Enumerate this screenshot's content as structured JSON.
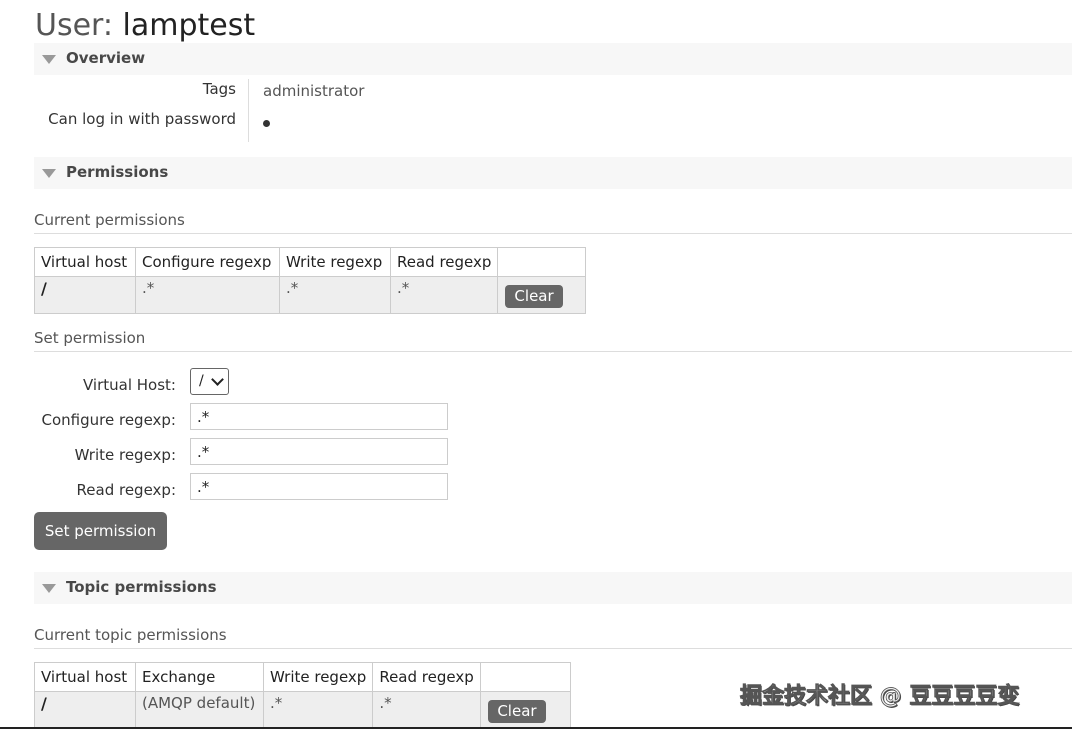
{
  "header": {
    "title_prefix": "User:",
    "title_name": "lamptest"
  },
  "overview": {
    "heading": "Overview",
    "tags_label": "Tags",
    "tags_value": "administrator",
    "password_label": "Can log in with password"
  },
  "permissions": {
    "heading": "Permissions",
    "current_heading": "Current permissions",
    "columns": [
      "Virtual host",
      "Configure regexp",
      "Write regexp",
      "Read regexp"
    ],
    "rows": [
      {
        "vhost": "/",
        "configure": ".*",
        "write": ".*",
        "read": ".*",
        "action": "Clear"
      }
    ],
    "set_heading": "Set permission",
    "form": {
      "vhost_label": "Virtual Host:",
      "vhost_value": "/",
      "configure_label": "Configure regexp:",
      "configure_value": ".*",
      "write_label": "Write regexp:",
      "write_value": ".*",
      "read_label": "Read regexp:",
      "read_value": ".*",
      "submit_label": "Set permission"
    }
  },
  "topic_permissions": {
    "heading": "Topic permissions",
    "current_heading": "Current topic permissions",
    "columns": [
      "Virtual host",
      "Exchange",
      "Write regexp",
      "Read regexp"
    ],
    "rows": [
      {
        "vhost": "/",
        "exchange": "(AMQP default)",
        "write": ".*",
        "read": ".*",
        "action": "Clear"
      }
    ]
  },
  "watermark": "掘金技术社区 @ 豆豆豆豆变",
  "colors": {
    "button_bg": "#666666",
    "section_bg": "#f7f7f7",
    "cell_bg": "#eeeeee"
  },
  "icons": {
    "section_toggle": "triangle-down-icon",
    "select_chevron": "chevron-down-icon",
    "password_flag": "bullet-dot-icon"
  }
}
